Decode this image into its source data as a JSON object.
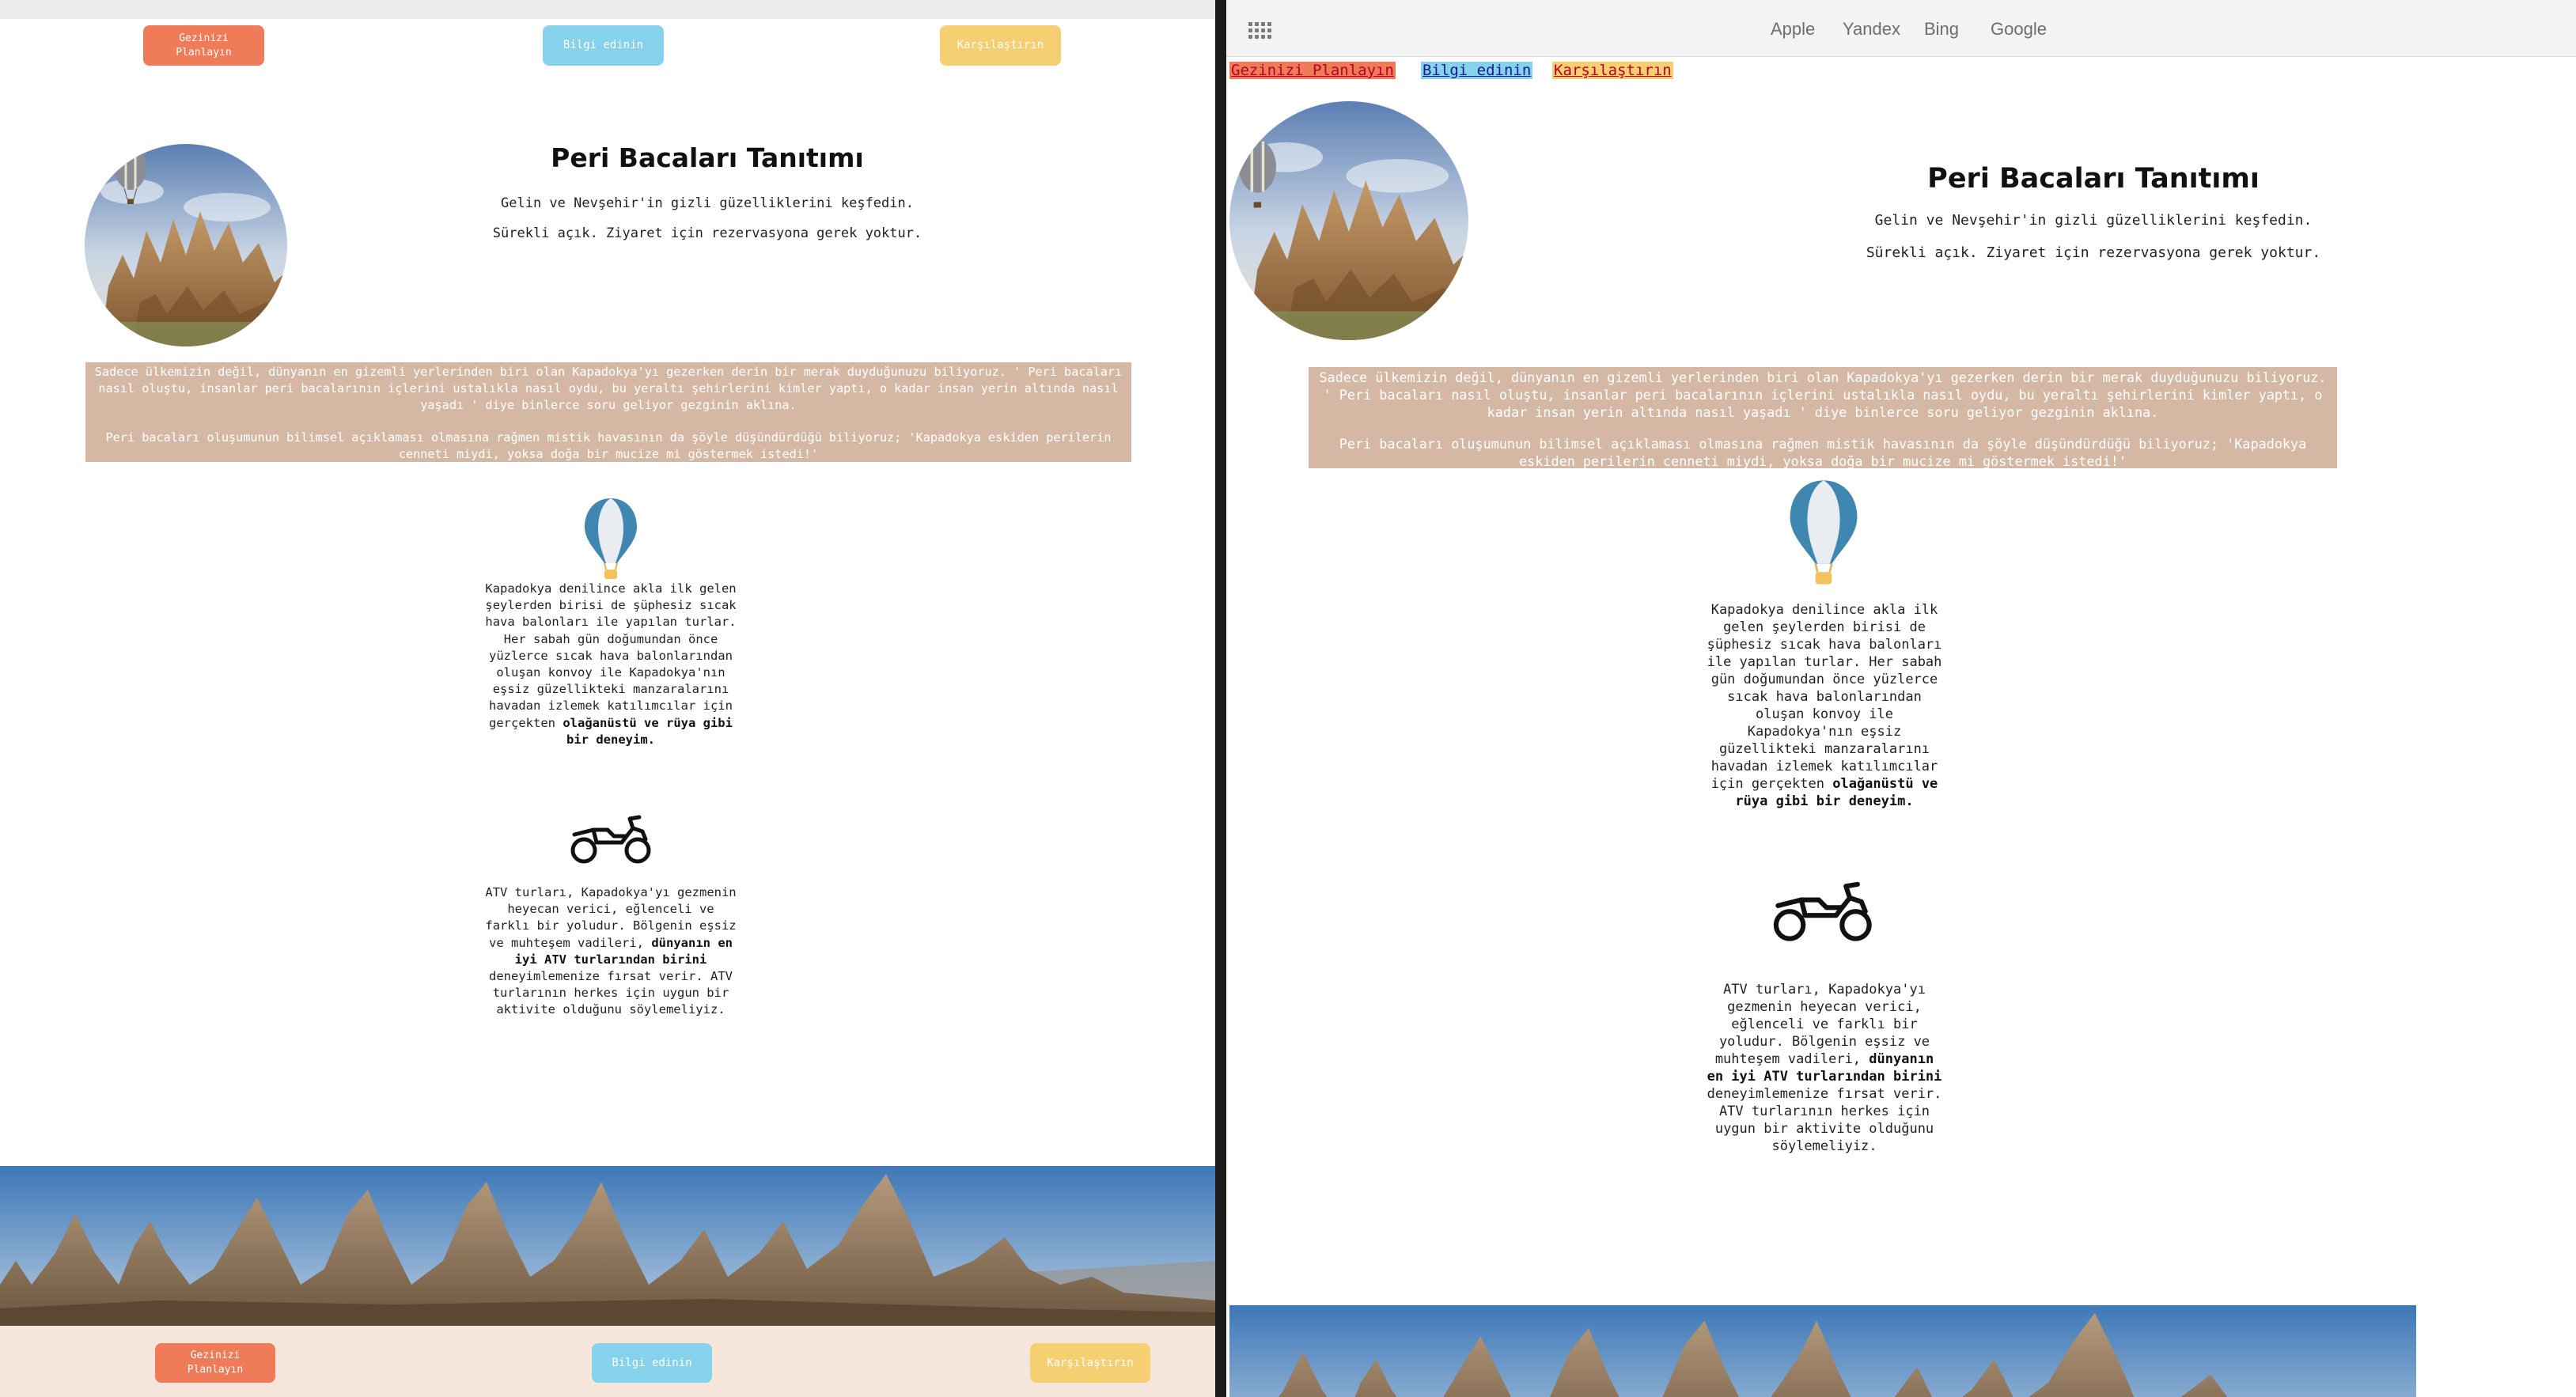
{
  "nav": {
    "plan": "Gezinizi Planlayın",
    "learn": "Bilgi edinin",
    "compare": "Karşılaştırın",
    "plan_wrapped": [
      "Gezinizi",
      "Planlayın"
    ]
  },
  "hero": {
    "title": "Peri Bacaları Tanıtımı",
    "subtitle1": "Gelin ve Nevşehir'in gizli güzelliklerini keşfedin.",
    "subtitle2": "Sürekli açık. Ziyaret için rezervasyona gerek yoktur."
  },
  "intro": {
    "para1": "Sadece ülkemizin değil, dünyanın en gizemli yerlerinden biri olan Kapadokya'yı gezerken derin bir merak duyduğunuzu biliyoruz. ' Peri bacaları nasıl oluştu, insanlar peri bacalarının içlerini ustalıkla nasıl oydu, bu yeraltı şehirlerini kimler yaptı, o kadar insan yerin altında nasıl yaşadı ' diye binlerce soru geliyor gezginin aklına.",
    "para2": "Peri bacaları oluşumunun bilimsel açıklaması olmasına rağmen mistik havasının da şöyle düşündürdüğü biliyoruz; 'Kapadokya eskiden perilerin cenneti miydi, yoksa doğa bir mucize mi göstermek istedi!'"
  },
  "balloon_section": {
    "icon": "hot-air-balloon-icon",
    "text": "Kapadokya denilince akla ilk gelen şeylerden birisi de şüphesiz sıcak hava balonları ile yapılan turlar. Her sabah gün doğumundan önce yüzlerce sıcak hava balonlarından oluşan konvoy ile Kapadokya'nın eşsiz güzellikteki manzaralarını havadan izlemek katılımcılar için gerçekten",
    "bold": "olağanüstü ve rüya gibi bir deneyim."
  },
  "atv_section": {
    "icon": "atv-motorbike-icon",
    "text1": "ATV turları, Kapadokya'yı gezmenin heyecan verici, eğlenceli ve farklı bir yoludur. Bölgenin eşsiz ve muhteşem vadileri,",
    "bold": "dünyanın en iyi ATV turlarından birini",
    "text2": "deneyimlemenize fırsat verir. ATV turlarının herkes için uygun bir aktivite olduğunu söylemeliyiz."
  },
  "browser": {
    "favorites": [
      "Apple",
      "Yandex",
      "Bing",
      "Google"
    ],
    "grid_icon": "apps-grid-icon"
  },
  "colors": {
    "orange": "#ef7b58",
    "blue": "#86d2ec",
    "yellow": "#f5cf71",
    "intro_bg": "#d5b8a4",
    "footer_bg": "#f5e5da"
  }
}
